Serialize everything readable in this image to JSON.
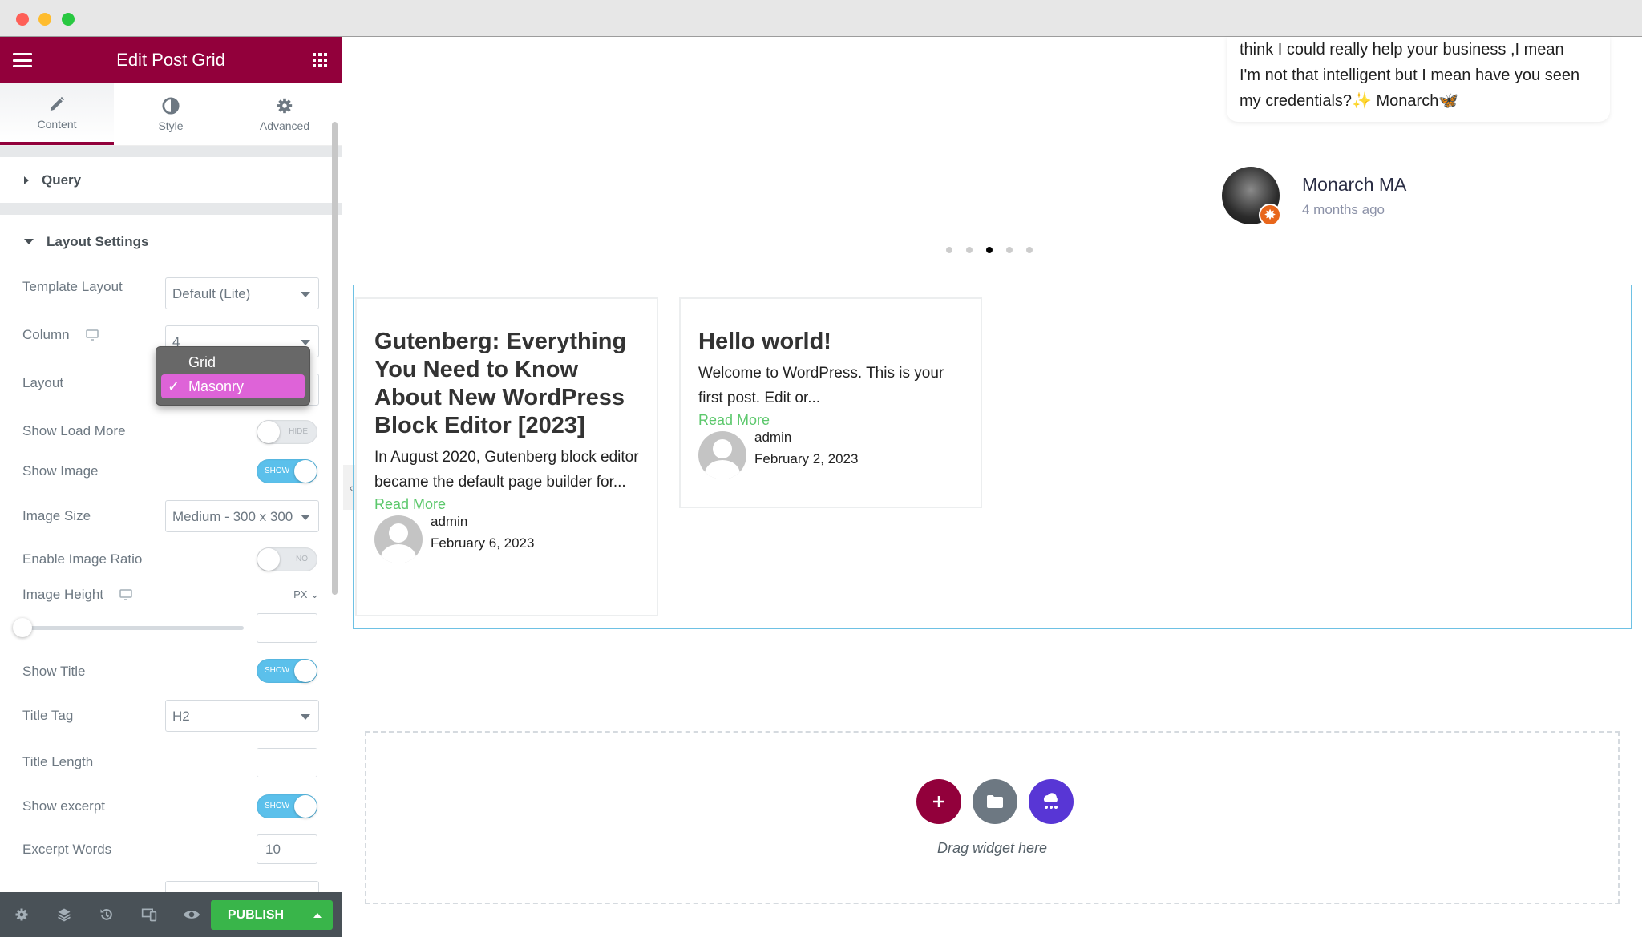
{
  "window": {
    "traffic_lights": {
      "close": "#fe5f57",
      "minimize": "#febc2e",
      "maximize": "#28c840"
    }
  },
  "panel": {
    "title": "Edit Post Grid",
    "menu_icon": "hamburger-icon",
    "apps_icon": "grid-apps-icon",
    "accent": "#92003b",
    "tabs": [
      {
        "label": "Content",
        "icon": "pencil-icon",
        "active": true
      },
      {
        "label": "Style",
        "icon": "half-circle-icon",
        "active": false
      },
      {
        "label": "Advanced",
        "icon": "gear-icon",
        "active": false
      }
    ],
    "sections": {
      "query": "Query",
      "layout": "Layout Settings"
    },
    "controls": {
      "template_layout": {
        "label": "Template Layout",
        "value": "Default (Lite)"
      },
      "column": {
        "label": "Column",
        "value": "4"
      },
      "layout": {
        "label": "Layout",
        "options": [
          "Grid",
          "Masonry"
        ],
        "selected": "Masonry",
        "check": "✓"
      },
      "show_load_more": {
        "label": "Show Load More",
        "state": "HIDE"
      },
      "show_image": {
        "label": "Show Image",
        "state": "SHOW"
      },
      "image_size": {
        "label": "Image Size",
        "value": "Medium - 300 x 300"
      },
      "enable_image_ratio": {
        "label": "Enable Image Ratio",
        "state": "NO"
      },
      "image_height": {
        "label": "Image Height",
        "unit": "PX",
        "value": "",
        "slider_value": 0
      },
      "show_title": {
        "label": "Show Title",
        "state": "SHOW"
      },
      "title_tag": {
        "label": "Title Tag",
        "value": "H2"
      },
      "title_length": {
        "label": "Title Length",
        "value": ""
      },
      "show_excerpt": {
        "label": "Show excerpt",
        "state": "SHOW"
      },
      "excerpt_words": {
        "label": "Excerpt Words",
        "value": "10"
      }
    },
    "footer": {
      "icons": [
        "settings-icon",
        "layers-icon",
        "history-icon",
        "responsive-icon",
        "preview-eye-icon"
      ],
      "publish_label": "PUBLISH",
      "publish_color": "#39b54a"
    }
  },
  "canvas": {
    "testimonial": {
      "lines": [
        "think I could really help your business ,I mean",
        "I'm not that intelligent but I mean have you seen",
        "my credentials?✨ Monarch🦋"
      ],
      "author": "Monarch MA",
      "time": "4 months ago",
      "badge": "✸"
    },
    "carousel": {
      "count": 5,
      "active_index": 2
    },
    "posts": [
      {
        "title": "Gutenberg: Everything You Need to Know About New WordPress Block Editor [2023]",
        "excerpt": "In August 2020, Gutenberg block editor became the default page builder for...",
        "read_more": "Read More",
        "author": "admin",
        "date": "February 6, 2023"
      },
      {
        "title": "Hello world!",
        "excerpt": "Welcome to WordPress. This is your first post. Edit or...",
        "read_more": "Read More",
        "author": "admin",
        "date": "February 2, 2023"
      }
    ],
    "dropzone": {
      "text": "Drag widget here",
      "buttons": [
        {
          "icon": "plus-icon",
          "color": "#92003b"
        },
        {
          "icon": "folder-icon",
          "color": "#6d7882"
        },
        {
          "icon": "cloud-kit-icon",
          "color": "#5836d5"
        }
      ]
    }
  }
}
